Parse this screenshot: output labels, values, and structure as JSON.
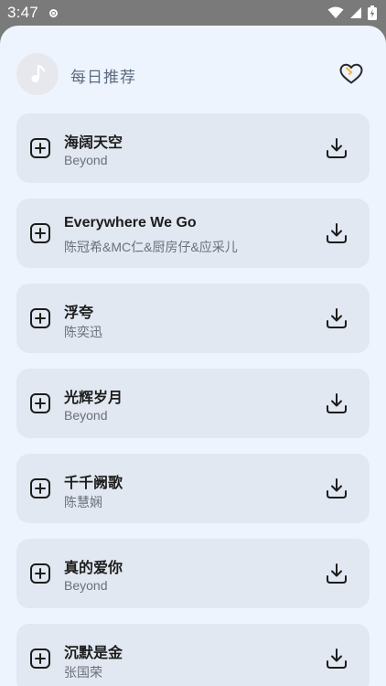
{
  "status": {
    "time": "3:47"
  },
  "header": {
    "title": "每日推荐"
  },
  "songs": [
    {
      "title": "海阔天空",
      "artist": "Beyond"
    },
    {
      "title": "Everywhere We Go",
      "artist": "陈冠希&MC仁&厨房仔&应采儿"
    },
    {
      "title": "浮夸",
      "artist": "陈奕迅"
    },
    {
      "title": "光辉岁月",
      "artist": "Beyond"
    },
    {
      "title": "千千阙歌",
      "artist": "陈慧娴"
    },
    {
      "title": "真的爱你",
      "artist": "Beyond"
    },
    {
      "title": "沉默是金",
      "artist": "张国荣"
    }
  ],
  "icons": {
    "avatar": "music-note-icon",
    "favorite": "heart-icon",
    "add": "add-to-playlist-icon",
    "download": "download-icon"
  },
  "colors": {
    "sheet_bg": "#eef4fe",
    "row_bg": "#e2e8f1",
    "status_bg": "#7a7a7a",
    "heart_accent": "#f2b94a"
  }
}
